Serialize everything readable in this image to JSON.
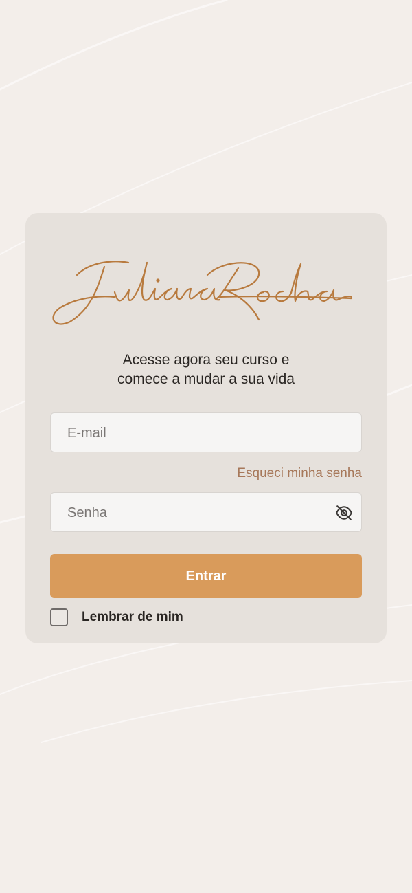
{
  "brand": {
    "logo_text": "Juliana Rocha",
    "logo_color": "#b87a3e"
  },
  "login": {
    "tagline_line1": "Acesse agora seu curso e",
    "tagline_line2": "comece a mudar a sua vida",
    "email_placeholder": "E-mail",
    "forgot_password": "Esqueci minha senha",
    "password_placeholder": "Senha",
    "submit_label": "Entrar",
    "remember_label": "Lembrar de mim",
    "remember_checked": false
  },
  "icons": {
    "password_toggle": "eye-off-icon"
  },
  "colors": {
    "background": "#f3eeea",
    "card": "#e6e1dc",
    "accent": "#d99b5b",
    "link": "#a7785a"
  }
}
